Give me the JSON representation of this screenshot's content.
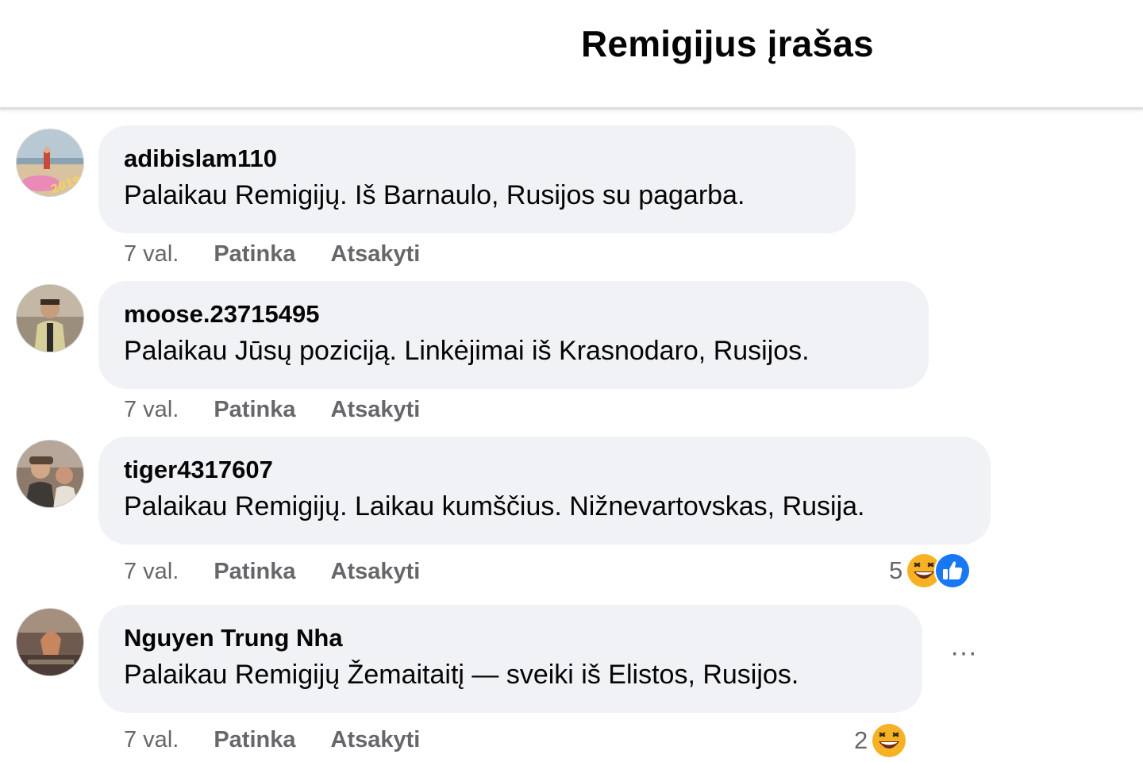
{
  "header": {
    "title": "Remigijus įrašas"
  },
  "comments": [
    {
      "author": "adibislam110",
      "text": "Palaikau Remigijų. Iš Barnaulo, Rusijos su pagarba.",
      "time": "7 val.",
      "like_label": "Patinka",
      "reply_label": "Atsakyti"
    },
    {
      "author": "moose.23715495",
      "text": "Palaikau Jūsų poziciją. Linkėjimai iš Krasnodaro, Rusijos.",
      "time": "7 val.",
      "like_label": "Patinka",
      "reply_label": "Atsakyti"
    },
    {
      "author": "tiger4317607",
      "text": "Palaikau Remigijų. Laikau kumščius. Nižnevartovskas, Rusija.",
      "time": "7 val.",
      "like_label": "Patinka",
      "reply_label": "Atsakyti",
      "reactions": {
        "count": "5",
        "types": [
          "haha",
          "like"
        ]
      }
    },
    {
      "author": "Nguyen Trung Nha",
      "text": "Palaikau Remigijų Žemaitaitį — sveiki iš Elistos, Rusijos.",
      "time": "7 val.",
      "like_label": "Patinka",
      "reply_label": "Atsakyti",
      "reactions": {
        "count": "2",
        "types": [
          "haha"
        ]
      },
      "more_label": "···"
    }
  ],
  "colors": {
    "bubble": "#f0f2f5",
    "meta_text": "#65676b",
    "like_blue": "#1877f2",
    "haha_yellow": "#f7b125"
  }
}
